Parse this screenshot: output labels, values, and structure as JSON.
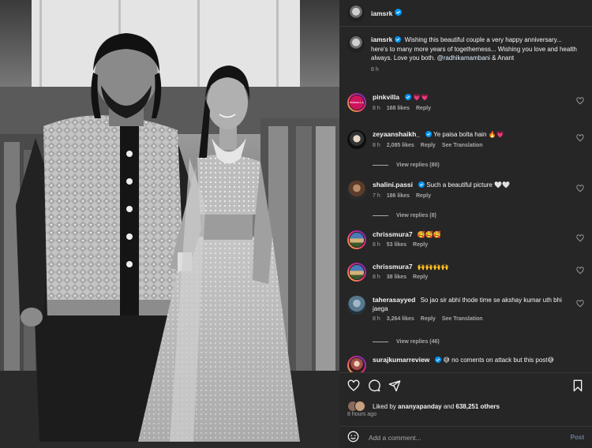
{
  "post": {
    "author": "iamsrk",
    "caption": {
      "text": "Wishing this beautiful couple a very happy anniversary... here's to many more years of togetherness... Wishing you love and health always. Love you both.",
      "mention": "@radhikamambani",
      "suffix": " & Anant",
      "time": "8 h"
    },
    "comments": [
      {
        "user": "pinkvilla",
        "text": "💗💗",
        "time": "8 h",
        "likes": "168 likes",
        "reply": "Reply",
        "avatar_label": "PINKVILLA",
        "verified": true
      },
      {
        "user": "zeyaanshaikh_",
        "text": "Ye paisa bolta hain 🔥💗",
        "time": "8 h",
        "likes": "2,085 likes",
        "reply": "Reply",
        "see_translation": "See Translation",
        "verified": true,
        "view_replies": "View replies (80)"
      },
      {
        "user": "shalini.passi",
        "text": "Such a beautiful picture 🤍🤍",
        "time": "7 h",
        "likes": "186 likes",
        "reply": "Reply",
        "verified": true,
        "view_replies": "View replies (8)"
      },
      {
        "user": "chrissmura7",
        "text": "🥰🥰🥰",
        "time": "8 h",
        "likes": "53 likes",
        "reply": "Reply",
        "verified": false
      },
      {
        "user": "chrissmura7",
        "text": "🙌🙌🙌🙌",
        "time": "8 h",
        "likes": "38 likes",
        "reply": "Reply",
        "verified": false
      },
      {
        "user": "taherasayyed",
        "text": "So jao sir abhi thode time se akshay kumar uth bhi jaega",
        "time": "8 h",
        "likes": "3,264 likes",
        "reply": "Reply",
        "see_translation": "See Translation",
        "verified": false,
        "view_replies": "View replies (46)"
      },
      {
        "user": "surajkumarreview",
        "text": "😅 no coments on attack but this post😅",
        "verified": true
      }
    ]
  },
  "likes": {
    "prefix": "Liked by ",
    "user": "ananyapanday",
    "middle": " and ",
    "count": "638,251 others"
  },
  "time_ago": "8 hours ago",
  "add_comment": {
    "placeholder": "Add a comment...",
    "post_label": "Post"
  },
  "icons": [
    "heart-icon",
    "comment-icon",
    "share-icon",
    "bookmark-icon",
    "emoji-icon",
    "verified-icon"
  ],
  "colors": {
    "panel_bg": "#262626",
    "verified": "#0095f6",
    "heart_liked": "#ff3040",
    "secondary_text": "#a8a8a8"
  }
}
